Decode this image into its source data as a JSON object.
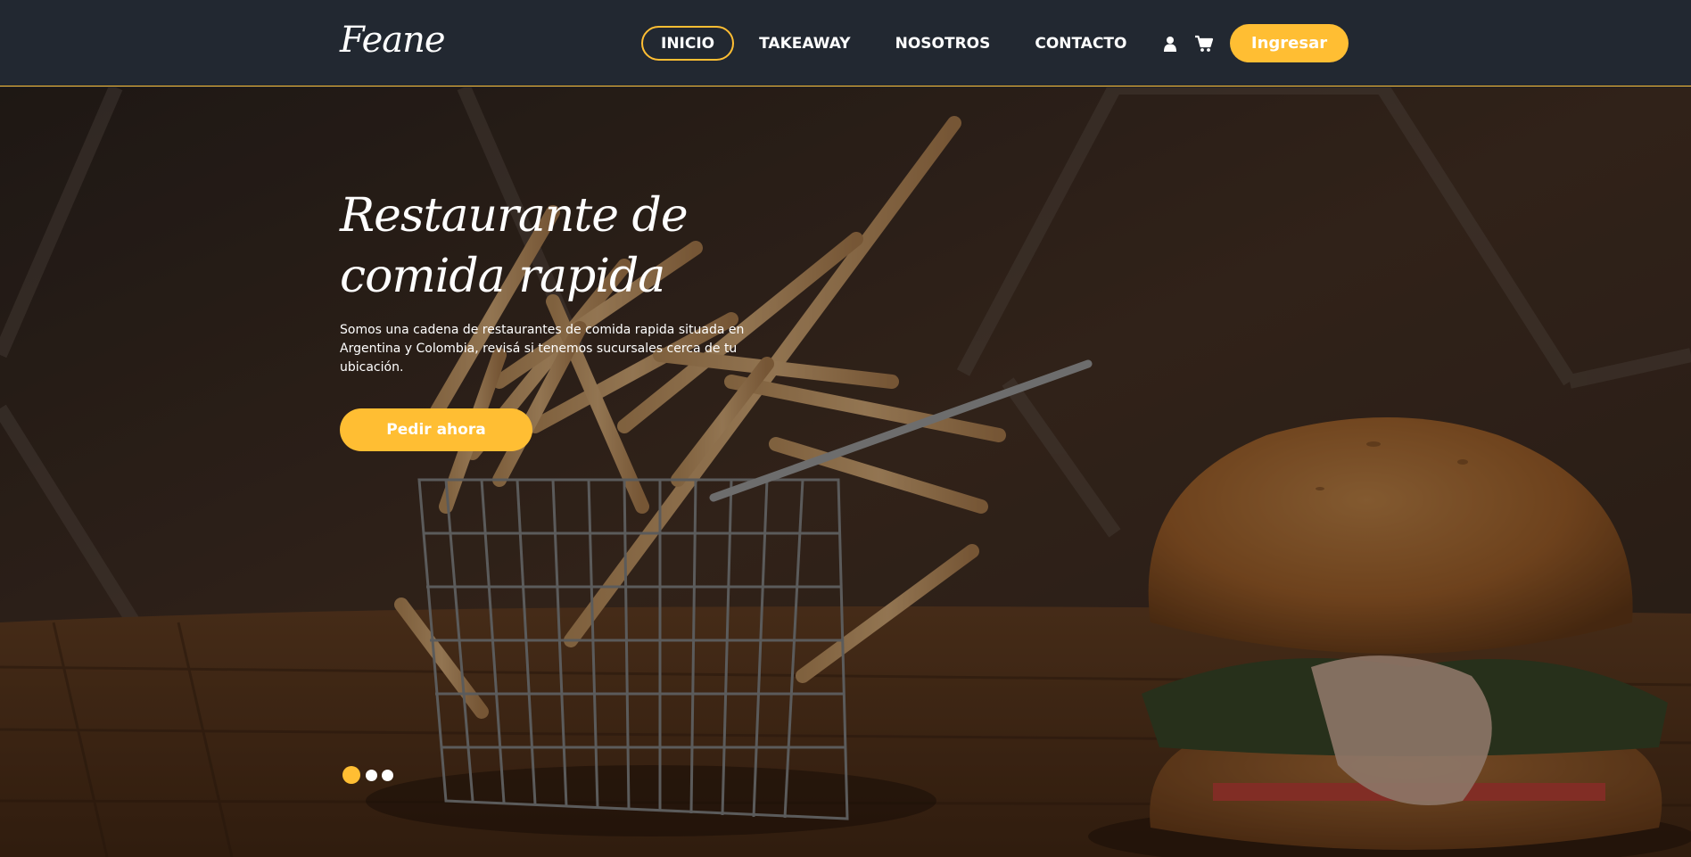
{
  "brand": {
    "logo": "Feane",
    "accent_color": "#ffbe33",
    "header_bg": "#222831"
  },
  "nav": {
    "items": [
      {
        "label": "INICIO",
        "active": true
      },
      {
        "label": "TAKEAWAY",
        "active": false
      },
      {
        "label": "NOSOTROS",
        "active": false
      },
      {
        "label": "CONTACTO",
        "active": false
      }
    ],
    "user_icon": "user-icon",
    "cart_icon": "cart-icon",
    "login_label": "Ingresar"
  },
  "hero": {
    "title": "Restaurante de comida rapida",
    "description": "Somos una cadena de restaurantes de comida rapida situada en Argentina y Colombia, revisá si tenemos sucursales cerca de tu ubicación.",
    "cta_label": "Pedir ahora",
    "background_image": "fries-basket-and-burger-photo",
    "slides": {
      "count": 3,
      "active_index": 0
    }
  }
}
